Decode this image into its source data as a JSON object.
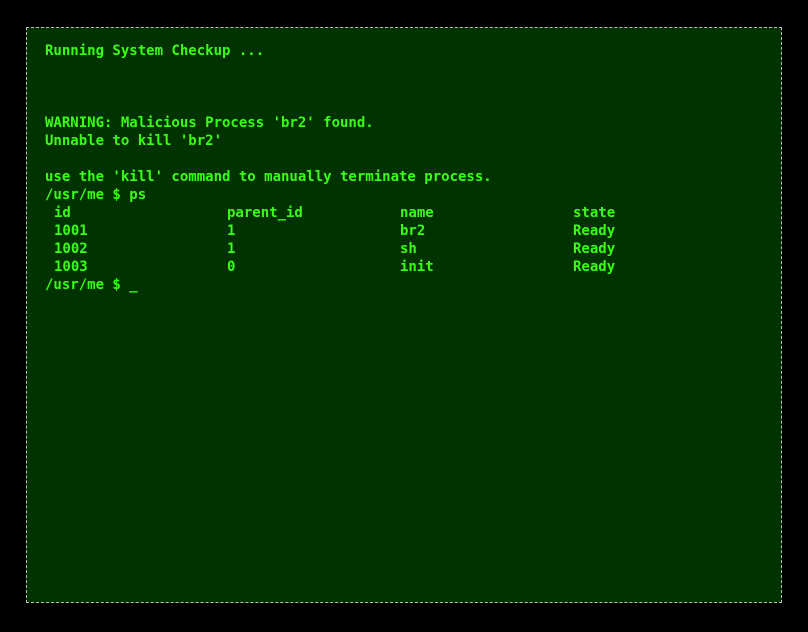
{
  "terminal": {
    "lines": {
      "checkup": "Running System Checkup ...",
      "warning": "WARNING: Malicious Process 'br2' found.",
      "unable": "Unnable to kill 'br2'",
      "hint": "use the 'kill' command to manually terminate process.",
      "ps_command": "/usr/me $ ps"
    },
    "ps_table": {
      "headers": [
        "id",
        "parent_id",
        "name",
        "state"
      ],
      "rows": [
        [
          "1001",
          "1",
          "br2",
          "Ready"
        ],
        [
          "1002",
          "1",
          "sh",
          "Ready"
        ],
        [
          "1003",
          "0",
          "init",
          "Ready"
        ]
      ]
    },
    "prompt": "/usr/me $ ",
    "cursor": "_",
    "colors": {
      "background": "#013300",
      "text": "#39ff14",
      "border": "#bdbdbd",
      "page": "#000000"
    }
  }
}
